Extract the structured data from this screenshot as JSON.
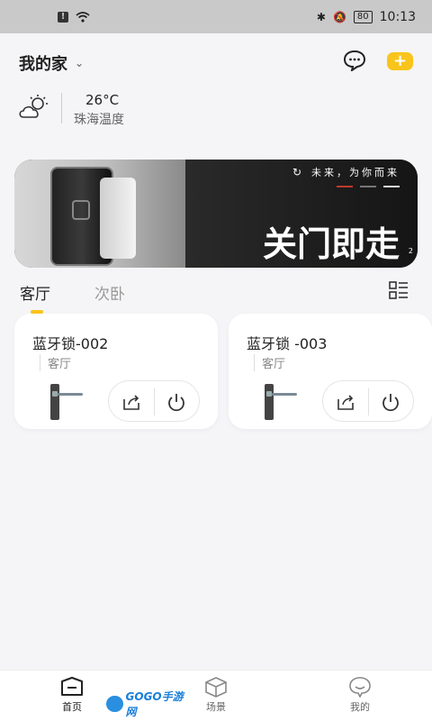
{
  "status_bar": {
    "battery": "80",
    "time": "10:13"
  },
  "header": {
    "home_name": "我的家",
    "add_label": "+"
  },
  "weather": {
    "temperature": "26°C",
    "label": "珠海温度"
  },
  "banner": {
    "slogan": "未来，为你而来",
    "title": "关门即走",
    "page_indicator": "2"
  },
  "tabs": [
    {
      "label": "客厅",
      "active": true
    },
    {
      "label": "次卧",
      "active": false
    }
  ],
  "devices": [
    {
      "name": "蓝牙锁-002",
      "room": "客厅"
    },
    {
      "name": "蓝牙锁 -003",
      "room": "客厅"
    }
  ],
  "bottom_nav": [
    {
      "label": "首页",
      "icon": "home-icon",
      "active": true
    },
    {
      "label": "场景",
      "icon": "cube-icon",
      "active": false
    },
    {
      "label": "我的",
      "icon": "profile-icon",
      "active": false
    }
  ],
  "watermark": {
    "text": "GOGO手游网"
  },
  "colors": {
    "accent": "#f9c41b",
    "background": "#f5f5f7"
  }
}
